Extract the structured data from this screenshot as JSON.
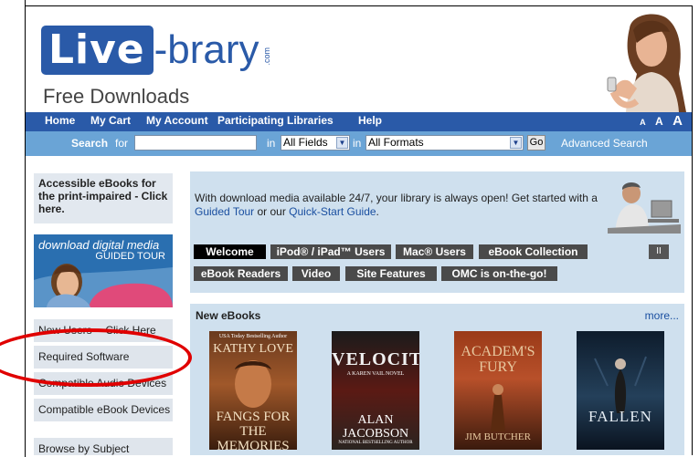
{
  "header": {
    "logo_live": "Live",
    "logo_brary": "-brary",
    "logo_dotcom": ".com",
    "tagline": "Free Downloads"
  },
  "nav": {
    "items": [
      "Home",
      "My Cart",
      "My Account",
      "Participating Libraries",
      "Help"
    ],
    "text_sizes": [
      "A",
      "A",
      "A"
    ]
  },
  "search": {
    "label": "Search",
    "for_label": "for",
    "query": "",
    "in1": "in",
    "field": "All Fields",
    "in2": "in",
    "format": "All Formats",
    "go": "Go",
    "advanced": "Advanced Search"
  },
  "sidebar": {
    "accessible": "Accessible eBooks for the print-impaired - Click here.",
    "guided_line1": "download digital media",
    "guided_line2": "GUIDED TOUR",
    "links": [
      "New Users -- Click Here",
      "Required Software",
      "Compatible Audio Devices",
      "Compatible eBook Devices",
      "Browse by Subject"
    ]
  },
  "welcome": {
    "text_before": "With download media available 24/7, your library is always open! Get started with a ",
    "link1": "Guided Tour",
    "text_mid": " or our ",
    "link2": "Quick-Start Guide",
    "text_after": ".",
    "tabs": [
      "Welcome",
      "iPod® / iPad™ Users",
      "Mac® Users",
      "eBook Collection",
      "eBook Readers",
      "Video",
      "Site Features",
      "OMC is on-the-go!"
    ],
    "pause": "II"
  },
  "ebooks": {
    "title": "New eBooks",
    "more": "more...",
    "books": [
      {
        "topline": "USA Today Bestselling Author",
        "author": "KATHY LOVE",
        "title": "FANGS FOR THE MEMORIES"
      },
      {
        "title": "VELOCITY",
        "subtitle": "A KAREN VAIL NOVEL",
        "author": "ALAN JACOBSON",
        "bottom": "NATIONAL BESTSELLING AUTHOR"
      },
      {
        "title": "ACADEM'S FURY",
        "author": "JIM BUTCHER"
      },
      {
        "title": "FALLEN"
      }
    ]
  },
  "colors": {
    "brand_blue": "#2a5aa8",
    "search_blue": "#6aa4d6",
    "panel_blue": "#cfe0ee",
    "annotation_red": "#e00000"
  }
}
